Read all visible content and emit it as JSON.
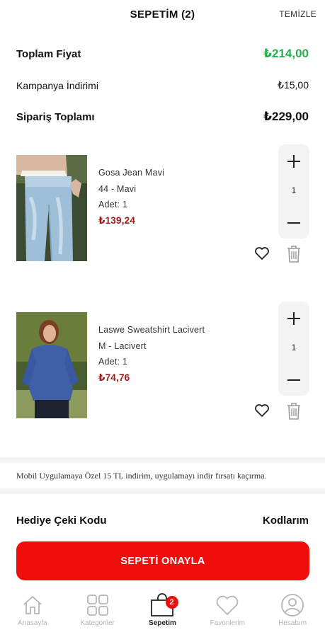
{
  "header": {
    "title": "SEPETİM  (2)",
    "clear_label": "TEMİZLE"
  },
  "summary": {
    "total_label": "Toplam Fiyat",
    "total_value": "₺214,00",
    "discount_label": "Kampanya İndirimi",
    "discount_value": "₺15,00",
    "order_label": "Sipariş Toplamı",
    "order_value": "₺229,00"
  },
  "items": [
    {
      "name": "Gosa Jean Mavi",
      "variant": "44 - Mavi",
      "qty_text": "Adet:  1",
      "price": "₺139,24",
      "qty": "1"
    },
    {
      "name": "Laswe Sweatshirt Lacivert",
      "variant": "M - Lacivert",
      "qty_text": "Adet:  1",
      "price": "₺74,76",
      "qty": "1"
    }
  ],
  "promo_text": "Mobil Uygulamaya Özel 15 TL indirim, uygulamayı indir fırsatı kaçırma.",
  "gift": {
    "label": "Hediye Çeki Kodu",
    "link": "Kodlarım"
  },
  "confirm_label": "SEPETİ ONAYLA",
  "tabs": [
    {
      "label": "Anasayfa",
      "icon": "home-icon"
    },
    {
      "label": "Kategoriler",
      "icon": "grid-icon"
    },
    {
      "label": "Sepetim",
      "icon": "bag-icon",
      "badge": "2"
    },
    {
      "label": "Favorilerim",
      "icon": "heart-icon"
    },
    {
      "label": "Hesabım",
      "icon": "user-icon"
    }
  ],
  "colors": {
    "accent": "#f20d0d",
    "total_green": "#21b24b",
    "price_red": "#a31a1a"
  }
}
